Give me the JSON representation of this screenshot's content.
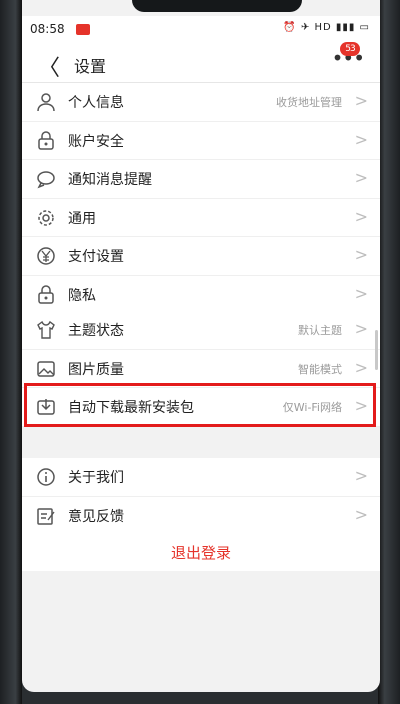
{
  "status": {
    "time": "08:58",
    "icons": "⏰ ✈ HD ▮▮▮ ▭"
  },
  "header": {
    "title": "设置",
    "back": "〈",
    "more": "•••",
    "badge": "53"
  },
  "group1": [
    {
      "label": "个人信息",
      "value": "收货地址管理",
      "icon": "person-icon"
    },
    {
      "label": "账户安全",
      "value": "",
      "icon": "lock-icon"
    },
    {
      "label": "通知消息提醒",
      "value": "",
      "icon": "chat-bubble-icon"
    },
    {
      "label": "通用",
      "value": "",
      "icon": "gear-icon"
    },
    {
      "label": "支付设置",
      "value": "",
      "icon": "yen-icon"
    },
    {
      "label": "隐私",
      "value": "",
      "icon": "privacy-lock-icon"
    }
  ],
  "group2": [
    {
      "label": "主题状态",
      "value": "默认主题",
      "icon": "tshirt-icon"
    },
    {
      "label": "图片质量",
      "value": "智能模式",
      "icon": "image-icon"
    },
    {
      "label": "自动下载最新安装包",
      "value": "仅Wi-Fi网络",
      "icon": "download-icon"
    }
  ],
  "group3": [
    {
      "label": "关于我们",
      "value": "",
      "icon": "info-icon"
    },
    {
      "label": "意见反馈",
      "value": "",
      "icon": "feedback-icon"
    }
  ],
  "logout": "退出登录",
  "chevron": ">",
  "colors": {
    "accent": "#e5332a",
    "highlight": "#e31b1b"
  }
}
